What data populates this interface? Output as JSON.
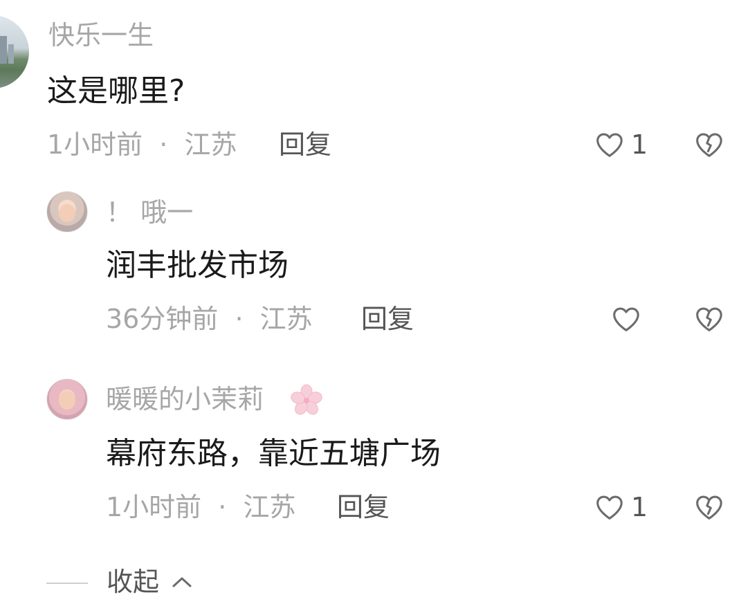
{
  "comments": [
    {
      "username": "快乐一生",
      "text": "这是哪里?",
      "time": "1小时前",
      "separator": "·",
      "location": "江苏",
      "reply_label": "回复",
      "likes": "1"
    }
  ],
  "replies": [
    {
      "username": "！ 哦一",
      "text": "润丰批发市场",
      "time": "36分钟前",
      "separator": "·",
      "location": "江苏",
      "reply_label": "回复",
      "likes": ""
    },
    {
      "username": "暖暖的小茉莉",
      "text": "幕府东路，靠近五塘广场",
      "time": "1小时前",
      "separator": "·",
      "location": "江苏",
      "reply_label": "回复",
      "likes": "1"
    }
  ],
  "collapse": {
    "label": "收起"
  },
  "icons": {
    "like": "heart-outline-icon",
    "dislike": "broken-heart-icon",
    "collapse": "chevron-up-icon",
    "username_badge": "cherry-blossom-icon"
  },
  "colors": {
    "text_primary": "#1a1a1a",
    "text_secondary": "#a6a6a6",
    "text_action": "#555555",
    "icon": "#6b6b6b",
    "badge": "#f5c6d3"
  }
}
